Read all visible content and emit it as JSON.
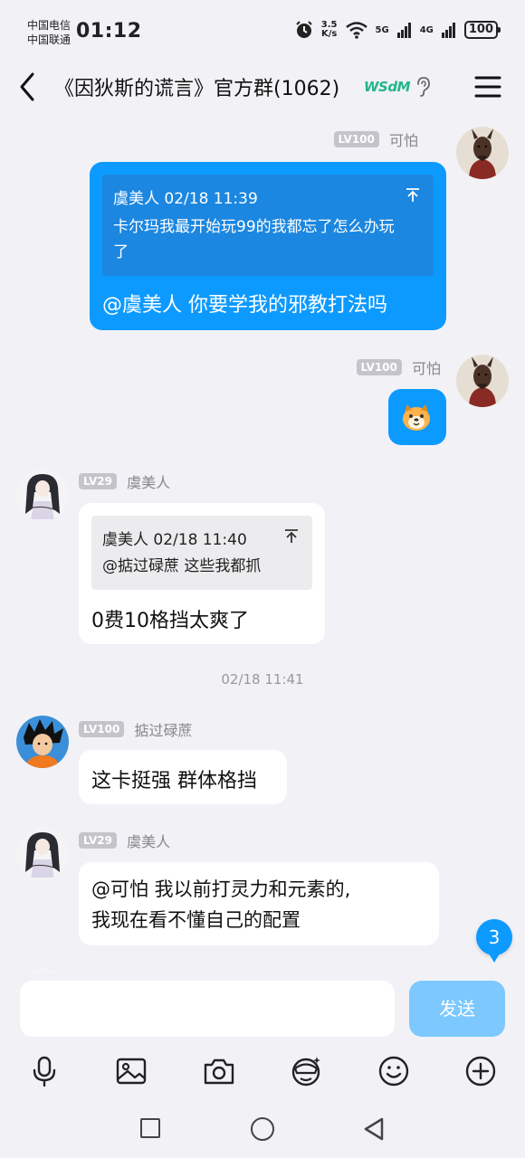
{
  "status": {
    "carrier1": "中国电信",
    "carrier2": "中国联通",
    "time": "01:12",
    "speed_top": "3.5",
    "speed_bottom": "K/s",
    "net1": "5G",
    "net2": "4G",
    "battery": "100"
  },
  "header": {
    "title": "《因狄斯的谎言》官方群(1062)",
    "badge": "WSdM"
  },
  "messages": [
    {
      "level": "LV100",
      "sender": "可怕",
      "quote_head": "虞美人 02/18 11:39",
      "quote_line1": "卡尔玛我最开始玩99的我都忘了怎么办玩",
      "quote_line2": "了",
      "text": "@虞美人 你要学我的邪教打法吗"
    },
    {
      "level": "LV100",
      "sender": "可怕"
    },
    {
      "level": "LV29",
      "sender": "虞美人",
      "quote_head": "虞美人 02/18 11:40",
      "quote_line1": "@掂过碌蔗 这些我都抓",
      "text": "0费10格挡太爽了"
    },
    {
      "level": "LV100",
      "sender": "掂过碌蔗",
      "text": "这卡挺强 群体格挡"
    },
    {
      "level": "LV29",
      "sender": "虞美人",
      "line1": "@可怕 我以前打灵力和元素的,",
      "line2": "我现在看不懂自己的配置"
    }
  ],
  "timestamp": "02/18 11:41",
  "unread_count": "3",
  "input": {
    "placeholder": "",
    "send_label": "发送"
  },
  "colors": {
    "accent": "#0d9aff",
    "send_disabled": "#7cc8ff",
    "background": "#f2f2f6"
  }
}
